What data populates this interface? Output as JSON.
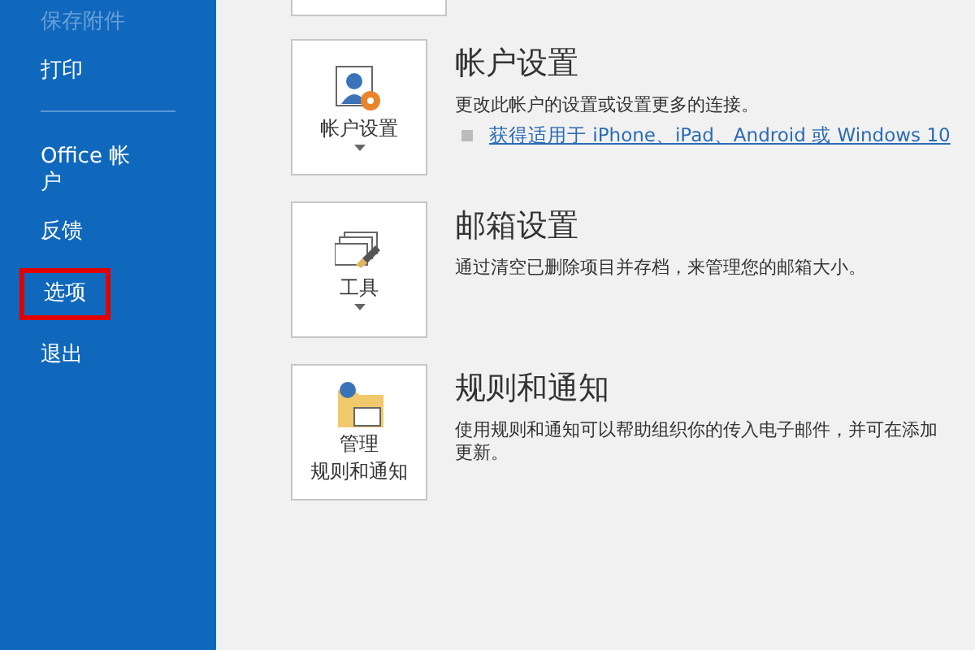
{
  "sidebar": {
    "items": [
      {
        "label": "保存附件",
        "disabled": true,
        "highlighted": false,
        "divider_after": false
      },
      {
        "label": "打印",
        "disabled": false,
        "highlighted": false,
        "divider_after": true
      },
      {
        "label": "Office 帐户",
        "disabled": false,
        "highlighted": false,
        "divider_after": false
      },
      {
        "label": "反馈",
        "disabled": false,
        "highlighted": false,
        "divider_after": false
      },
      {
        "label": "选项",
        "disabled": false,
        "highlighted": true,
        "divider_after": false
      },
      {
        "label": "退出",
        "disabled": false,
        "highlighted": false,
        "divider_after": false
      }
    ]
  },
  "sections": [
    {
      "kind": "account",
      "button_label": [
        "帐户设置"
      ],
      "dropdown": true,
      "title": "帐户设置",
      "description": "更改此帐户的设置或设置更多的连接。",
      "link": "获得适用于 iPhone、iPad、Android 或 Windows 10"
    },
    {
      "kind": "tools",
      "button_label": [
        "工具"
      ],
      "dropdown": true,
      "title": "邮箱设置",
      "description": "通过清空已删除项目并存档，来管理您的邮箱大小。"
    },
    {
      "kind": "rules",
      "button_label": [
        "管理",
        "规则和通知"
      ],
      "dropdown": false,
      "title": "规则和通知",
      "description": "使用规则和通知可以帮助组织你的传入电子邮件，并可在添加更新。"
    }
  ]
}
